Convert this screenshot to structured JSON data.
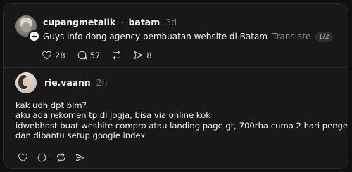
{
  "post": {
    "username": "cupangmetalik",
    "separator": "›",
    "topic": "batam",
    "time": "3d",
    "text": "Guys info dong agency pembuatan website di Batam",
    "translate": "Translate",
    "page_indicator": "1/2",
    "actions": {
      "likes": "28",
      "comments": "57",
      "shares": "8"
    }
  },
  "reply": {
    "username": "rie.vaann",
    "time": "2h",
    "lines": [
      "kak udh dpt blm?",
      "aku ada rekomen tp di jogja, bisa via online kok",
      "idwebhost buat wesbite compro atau landing page gt, 700rba cuma 2 hari pengerjaan",
      "dan dibantu setup google index"
    ]
  },
  "icons": {
    "like": "heart-icon",
    "comment": "comment-icon",
    "repost": "repost-icon",
    "share": "share-icon",
    "follow": "plus-icon",
    "chevron": "chevron-right-icon"
  },
  "colors": {
    "background": "#101010",
    "card": "#181818",
    "text": "#f3f5f7",
    "muted": "#777777"
  }
}
